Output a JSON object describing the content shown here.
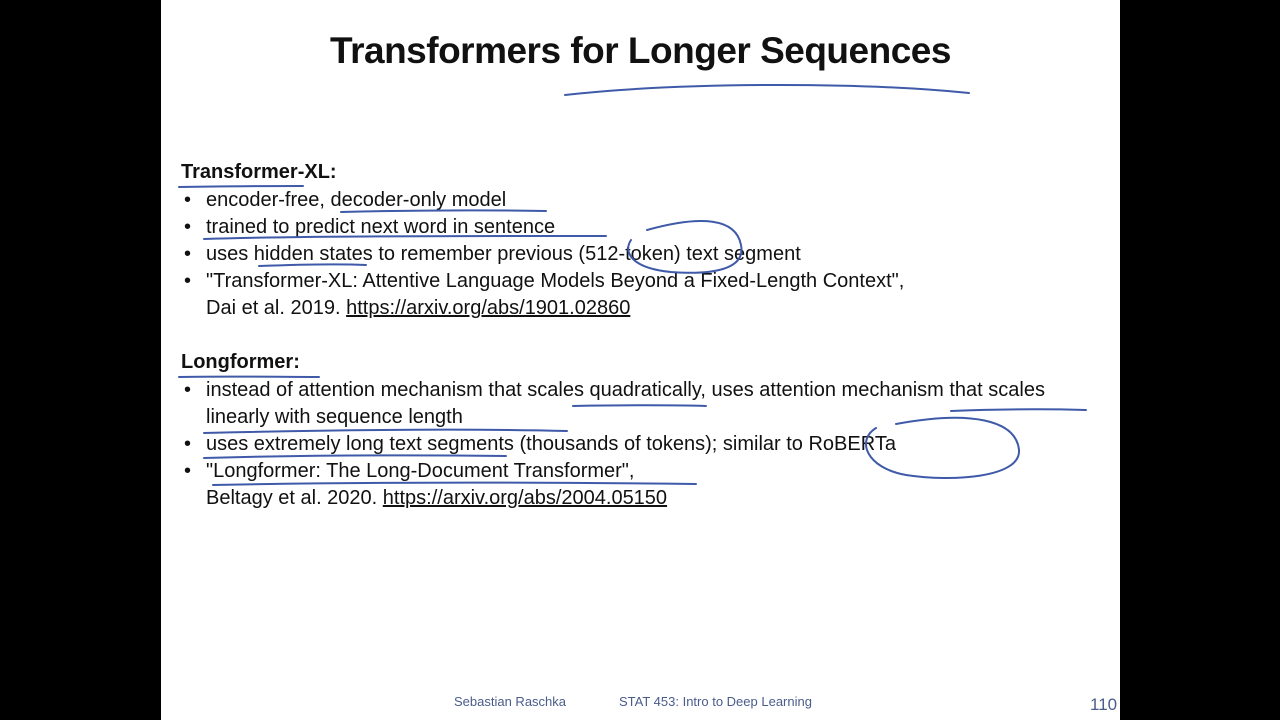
{
  "title": "Transformers for Longer Sequences",
  "sections": [
    {
      "heading": "Transformer-XL:",
      "items": [
        {
          "text": "encoder-free, decoder-only model"
        },
        {
          "text": "trained to predict next word in sentence"
        },
        {
          "text": "uses hidden states to remember previous (512-token) text segment"
        },
        {
          "text": "\"Transformer-XL: Attentive Language Models Beyond a Fixed-Length Context\",",
          "cite": "Dai et al. 2019. ",
          "link": "https://arxiv.org/abs/1901.02860"
        }
      ]
    },
    {
      "heading": "Longformer:",
      "items": [
        {
          "text": "instead of attention mechanism that scales quadratically, uses attention mechanism that scales linearly with sequence length"
        },
        {
          "text": "uses extremely long text segments (thousands of tokens); similar to RoBERTa"
        },
        {
          "text": "\"Longformer: The Long-Document Transformer\",",
          "cite": "Beltagy et al. 2020. ",
          "link": "https://arxiv.org/abs/2004.05150"
        }
      ]
    }
  ],
  "footer": {
    "author": "Sebastian Raschka",
    "course": "STAT 453: Intro to Deep Learning",
    "page": "110"
  },
  "colors": {
    "annotation": "#3f5aa8",
    "footer_text": "#4a5c8a"
  }
}
